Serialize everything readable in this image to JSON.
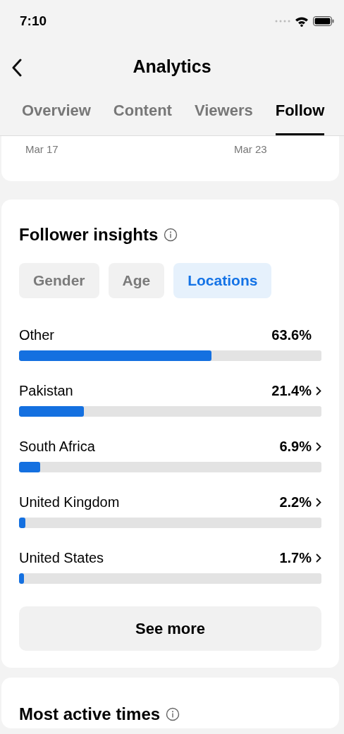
{
  "status_bar": {
    "time": "7:10"
  },
  "header": {
    "title": "Analytics"
  },
  "tabs": [
    {
      "label": "Overview",
      "selected": false
    },
    {
      "label": "Content",
      "selected": false
    },
    {
      "label": "Viewers",
      "selected": false
    },
    {
      "label": "Follow",
      "selected": true
    }
  ],
  "chart_axis": {
    "labels": [
      "Mar 17",
      "Mar 23"
    ]
  },
  "follower_insights": {
    "title": "Follower insights",
    "filters": [
      {
        "label": "Gender",
        "selected": false
      },
      {
        "label": "Age",
        "selected": false
      },
      {
        "label": "Locations",
        "selected": true
      }
    ],
    "rows": [
      {
        "name": "Other",
        "value": "63.6%",
        "level": 0.636,
        "has_chevron": false
      },
      {
        "name": "Pakistan",
        "value": "21.4%",
        "level": 0.214,
        "has_chevron": true
      },
      {
        "name": "South Africa",
        "value": "6.9%",
        "level": 0.069,
        "has_chevron": true
      },
      {
        "name": "United Kingdom",
        "value": "2.2%",
        "level": 0.022,
        "has_chevron": true
      },
      {
        "name": "United States",
        "value": "1.7%",
        "level": 0.017,
        "has_chevron": true
      }
    ],
    "button": "See more"
  },
  "most_active_times": {
    "title": "Most active times"
  }
}
